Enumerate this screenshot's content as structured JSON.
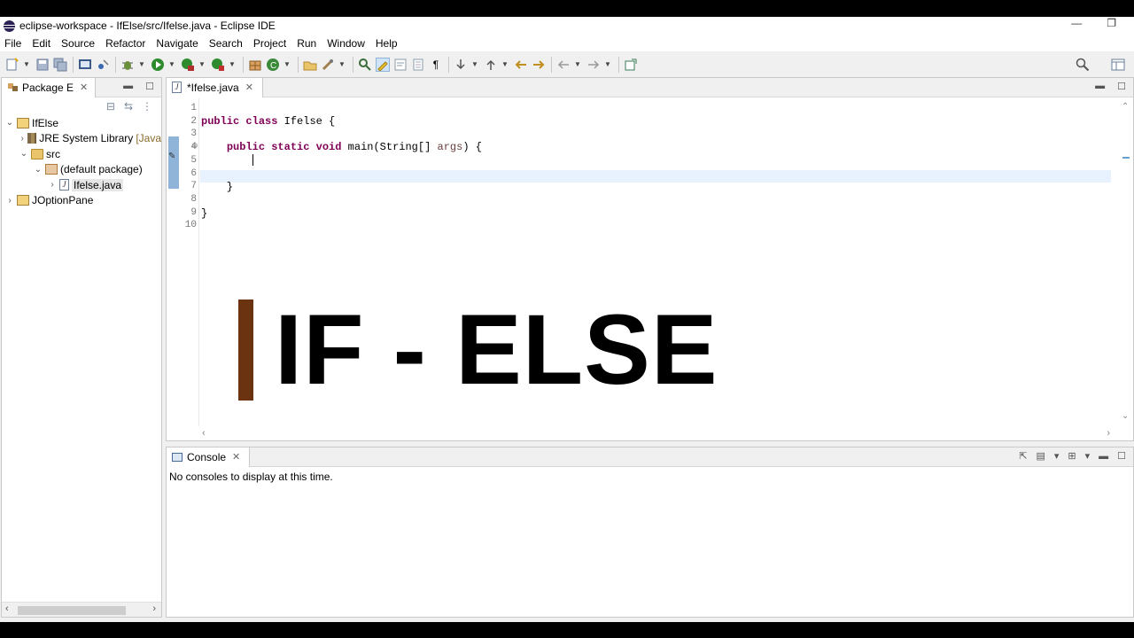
{
  "window": {
    "title": "eclipse-workspace - IfElse/src/Ifelse.java - Eclipse IDE",
    "minimize": "—",
    "restore": "❐"
  },
  "menu": [
    "File",
    "Edit",
    "Source",
    "Refactor",
    "Navigate",
    "Search",
    "Project",
    "Run",
    "Window",
    "Help"
  ],
  "package_explorer": {
    "tab_label": "Package E",
    "tree": [
      {
        "label": "IfElse",
        "twisty": "⌄",
        "icon": "project-icon"
      },
      {
        "label": "JRE System Library",
        "suffix": "[Java",
        "twisty": "›",
        "icon": "library-icon"
      },
      {
        "label": "src",
        "twisty": "⌄",
        "icon": "source-folder-icon"
      },
      {
        "label": "(default package)",
        "twisty": "⌄",
        "icon": "package-icon"
      },
      {
        "label": "Ifelse.java",
        "twisty": "›",
        "icon": "java-file-icon"
      },
      {
        "label": "JOptionPane",
        "twisty": "›",
        "icon": "project-icon"
      }
    ]
  },
  "editor": {
    "tab_label": "*Ifelse.java",
    "line_numbers": [
      "1",
      "2",
      "3",
      "4",
      "5",
      "6",
      "7",
      "8",
      "9",
      "10"
    ],
    "code": {
      "l2_kw1": "public",
      "l2_kw2": "class",
      "l2_rest": " Ifelse {",
      "l4_kw1": "public",
      "l4_kw2": "static",
      "l4_kw3": "void",
      "l4_mid": " main(String[] ",
      "l4_param": "args",
      "l4_end": ") {",
      "l7": "    }",
      "l9": "}"
    }
  },
  "overlay": {
    "text": "IF - ELSE",
    "accent_color": "#6b3310"
  },
  "console": {
    "tab_label": "Console",
    "message": "No consoles to display at this time."
  }
}
